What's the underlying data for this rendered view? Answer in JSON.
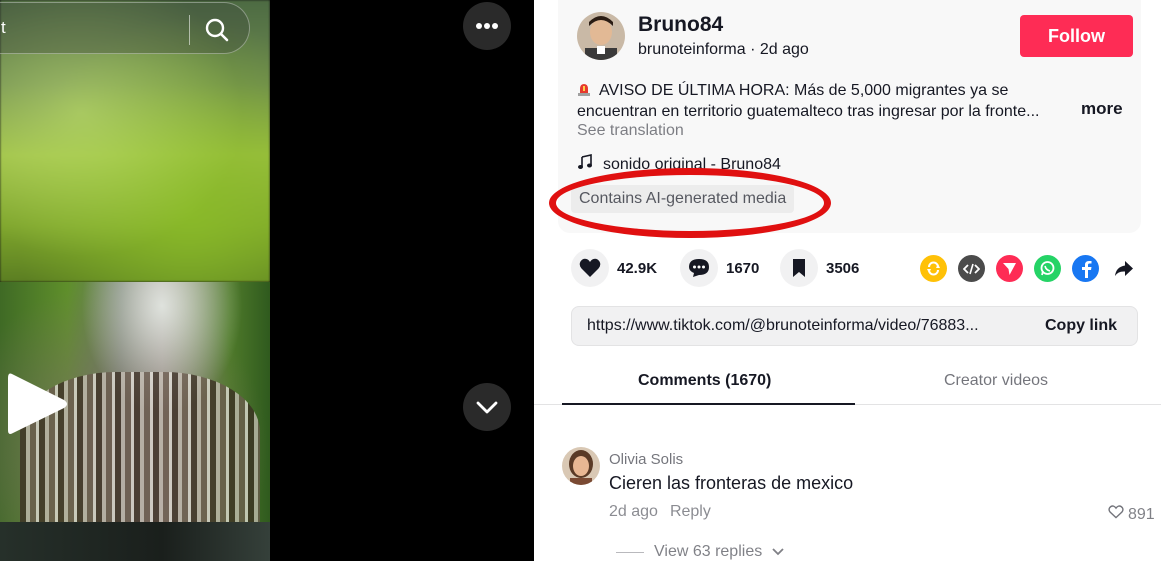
{
  "search": {
    "partial_text": "t"
  },
  "post": {
    "author_name": "Bruno84",
    "author_handle": "brunoteinforma",
    "time_ago": "2d ago",
    "follow_label": "Follow",
    "description": "AVISO DE ÚLTIMA HORA: Más de 5,000 migrantes ya se encuentran en territorio guatemalteco tras ingresar por la fronte...",
    "more_label": "more",
    "see_translation": "See translation",
    "music": "sonido original - Bruno84",
    "ai_label": "Contains AI-generated media"
  },
  "stats": {
    "likes": "42.9K",
    "comments": "1670",
    "saves": "3506"
  },
  "link": {
    "url": "https://www.tiktok.com/@brunoteinforma/video/76883...",
    "copy_label": "Copy link"
  },
  "tabs": {
    "comments": "Comments (1670)",
    "creator_videos": "Creator videos"
  },
  "comment": {
    "user": "Olivia Solis",
    "text": "Cieren las fronteras de mexico",
    "time_ago": "2d ago",
    "reply_label": "Reply",
    "likes": "891",
    "view_replies": "View 63 replies"
  },
  "colors": {
    "follow": "#fe2c55",
    "annotation": "#e01010"
  },
  "icons": [
    "search-icon",
    "play-icon",
    "more-options-icon",
    "chevron-down-icon",
    "heart-icon",
    "comment-icon",
    "bookmark-icon",
    "repost-icon",
    "embed-icon",
    "send-icon",
    "whatsapp-icon",
    "facebook-icon",
    "share-arrow-icon",
    "music-note-icon",
    "siren-icon"
  ]
}
